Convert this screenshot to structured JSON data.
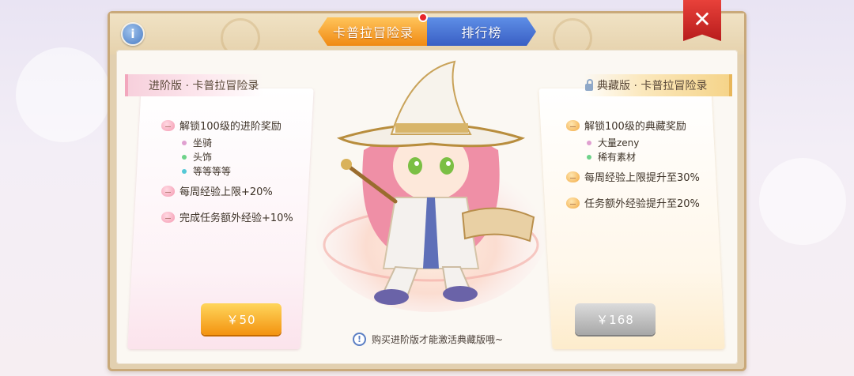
{
  "header": {
    "info_glyph": "i",
    "tabs": [
      {
        "label": "卡普拉冒险录",
        "active": true,
        "has_badge": true
      },
      {
        "label": "排行榜",
        "active": false
      }
    ],
    "close_glyph": "✕"
  },
  "advanced": {
    "title": "进阶版 · 卡普拉冒险录",
    "benefits": [
      {
        "text": "解锁100级的进阶奖励"
      },
      {
        "text": "每周经验上限+20%"
      },
      {
        "text": "完成任务额外经验+10%"
      }
    ],
    "rewards": [
      {
        "text": "坐骑",
        "color": "#e0a0d0"
      },
      {
        "text": "头饰",
        "color": "#6ed28a"
      },
      {
        "text": "等等等等",
        "color": "#54c8d6"
      }
    ],
    "price": "￥50"
  },
  "collector": {
    "title": "典藏版 · 卡普拉冒险录",
    "benefits": [
      {
        "text": "解锁100级的典藏奖励"
      },
      {
        "text": "每周经验上限提升至30%"
      },
      {
        "text": "任务额外经验提升至20%"
      }
    ],
    "rewards": [
      {
        "text": "大量zeny",
        "color": "#e0a0d0"
      },
      {
        "text": "稀有素材",
        "color": "#6ed28a"
      }
    ],
    "price": "￥168"
  },
  "footer": {
    "notice_glyph": "!",
    "notice": "购买进阶版才能激活典藏版哦~"
  },
  "colors": {
    "tab_active": "#f08a14",
    "tab_inactive": "#3a5fc4",
    "close": "#c8201f",
    "buy_enabled": "#f39310",
    "buy_disabled": "#a7a7a7"
  }
}
